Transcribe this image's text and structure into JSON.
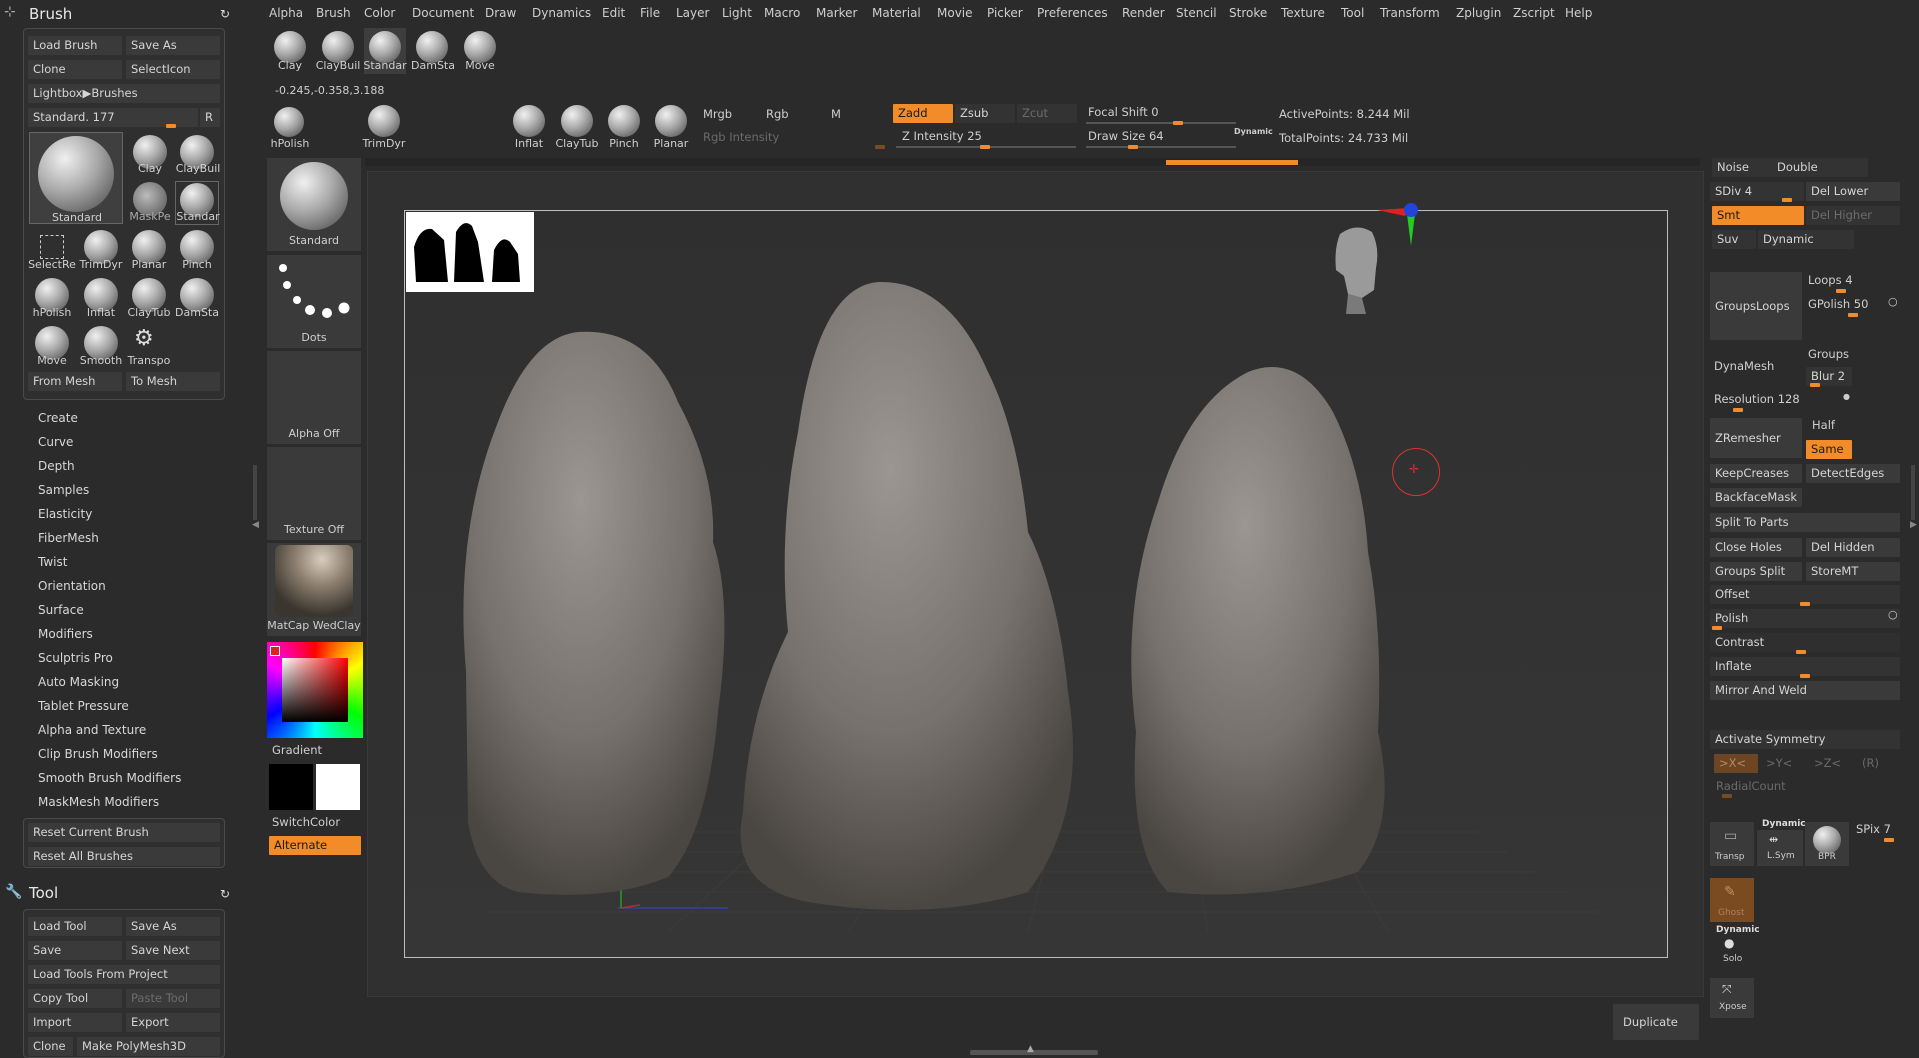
{
  "menu": [
    "Alpha",
    "Brush",
    "Color",
    "Document",
    "Draw",
    "Dynamics",
    "Edit",
    "File",
    "Layer",
    "Light",
    "Macro",
    "Marker",
    "Material",
    "Movie",
    "Picker",
    "Preferences",
    "Render",
    "Stencil",
    "Stroke",
    "Texture",
    "Tool",
    "Transform",
    "Zplugin",
    "Zscript",
    "Help"
  ],
  "brush_panel": {
    "title": "Brush",
    "load_brush": "Load Brush",
    "save_as": "Save As",
    "clone": "Clone",
    "select_icon": "SelectIcon",
    "lightbox": "Lightbox▶Brushes",
    "current": "Standard. 177",
    "r_label": "R",
    "brushes": [
      "Standard",
      "Clay",
      "ClayBuil",
      "MaskPe",
      "Standar",
      "SelectRe",
      "TrimDyr",
      "Planar",
      "Pinch",
      "hPolish",
      "Inflat",
      "ClayTub",
      "DamSta",
      "Move",
      "Smooth",
      "Transpo"
    ],
    "from_mesh": "From Mesh",
    "to_mesh": "To Mesh",
    "items": [
      "Create",
      "Curve",
      "Depth",
      "Samples",
      "Elasticity",
      "FiberMesh",
      "Twist",
      "Orientation",
      "Surface",
      "Modifiers",
      "Sculptris Pro",
      "Auto Masking",
      "Tablet Pressure",
      "Alpha and Texture",
      "Clip Brush Modifiers",
      "Smooth Brush Modifiers",
      "MaskMesh Modifiers"
    ],
    "reset_current": "Reset Current Brush",
    "reset_all": "Reset All Brushes"
  },
  "tool_panel": {
    "title": "Tool",
    "load_tool": "Load Tool",
    "save_as": "Save As",
    "save": "Save",
    "save_next": "Save Next",
    "load_from_project": "Load Tools From Project",
    "copy_tool": "Copy Tool",
    "paste_tool": "Paste Tool",
    "import": "Import",
    "export": "Export",
    "clone": "Clone",
    "make_polymesh": "Make PolyMesh3D"
  },
  "top_brushes": [
    "Clay",
    "ClayBuil",
    "Standar",
    "DamSta",
    "Move"
  ],
  "coords": "-0.245,-0.358,3.188",
  "shelf2": [
    "hPolish",
    "TrimDyr",
    "Inflat",
    "ClayTub",
    "Pinch",
    "Planar"
  ],
  "toolbar": {
    "mrgb": "Mrgb",
    "rgb": "Rgb",
    "m": "M",
    "rgb_intensity": "Rgb Intensity",
    "zadd": "Zadd",
    "zsub": "Zsub",
    "zcut": "Zcut",
    "z_intensity": "Z Intensity 25",
    "focal_shift": "Focal Shift 0",
    "draw_size": "Draw Size 64",
    "dynamic": "Dynamic",
    "active_points": "ActivePoints: 8.244 Mil",
    "total_points": "TotalPoints: 24.733 Mil"
  },
  "side_tray": {
    "brush": "Standard",
    "stroke": "Dots",
    "alpha": "Alpha Off",
    "texture": "Texture Off",
    "material": "MatCap WedClay",
    "gradient": "Gradient",
    "switch_color": "SwitchColor",
    "alternate": "Alternate"
  },
  "right_panel": {
    "noise": "Noise",
    "double": "Double",
    "sdiv": "SDiv 4",
    "del_lower": "Del Lower",
    "smt": "Smt",
    "del_higher": "Del Higher",
    "suv": "Suv",
    "dynamic": "Dynamic",
    "groups_loops": "GroupsLoops",
    "loops": "Loops 4",
    "gpolish": "GPolish 50",
    "dynamesh": "DynaMesh",
    "groups": "Groups",
    "blur": "Blur 2",
    "resolution": "Resolution 128",
    "zremesher": "ZRemesher",
    "half": "Half",
    "same": "Same",
    "keep_creases": "KeepCreases",
    "detect_edges": "DetectEdges",
    "backface_mask": "BackfaceMask",
    "split_to_parts": "Split To Parts",
    "close_holes": "Close Holes",
    "del_hidden": "Del Hidden",
    "groups_split": "Groups Split",
    "store_mt": "StoreMT",
    "offset": "Offset",
    "polish": "Polish",
    "contrast": "Contrast",
    "inflate": "Inflate",
    "mirror_weld": "Mirror And Weld",
    "activate_symmetry": "Activate Symmetry",
    "sym_x": ">X<",
    "sym_y": ">Y<",
    "sym_z": ">Z<",
    "sym_r": "(R)",
    "radial_count": "RadialCount",
    "transp": "Transp",
    "dynamic_small": "Dynamic",
    "lsym": "L.Sym",
    "bpr": "BPR",
    "spix": "SPix 7",
    "ghost": "Ghost",
    "solo": "Solo",
    "xpose": "Xpose",
    "duplicate": "Duplicate"
  },
  "colors": {
    "accent": "#f28c28",
    "panel": "#3a3a3a",
    "bg": "#2b2b2b"
  }
}
